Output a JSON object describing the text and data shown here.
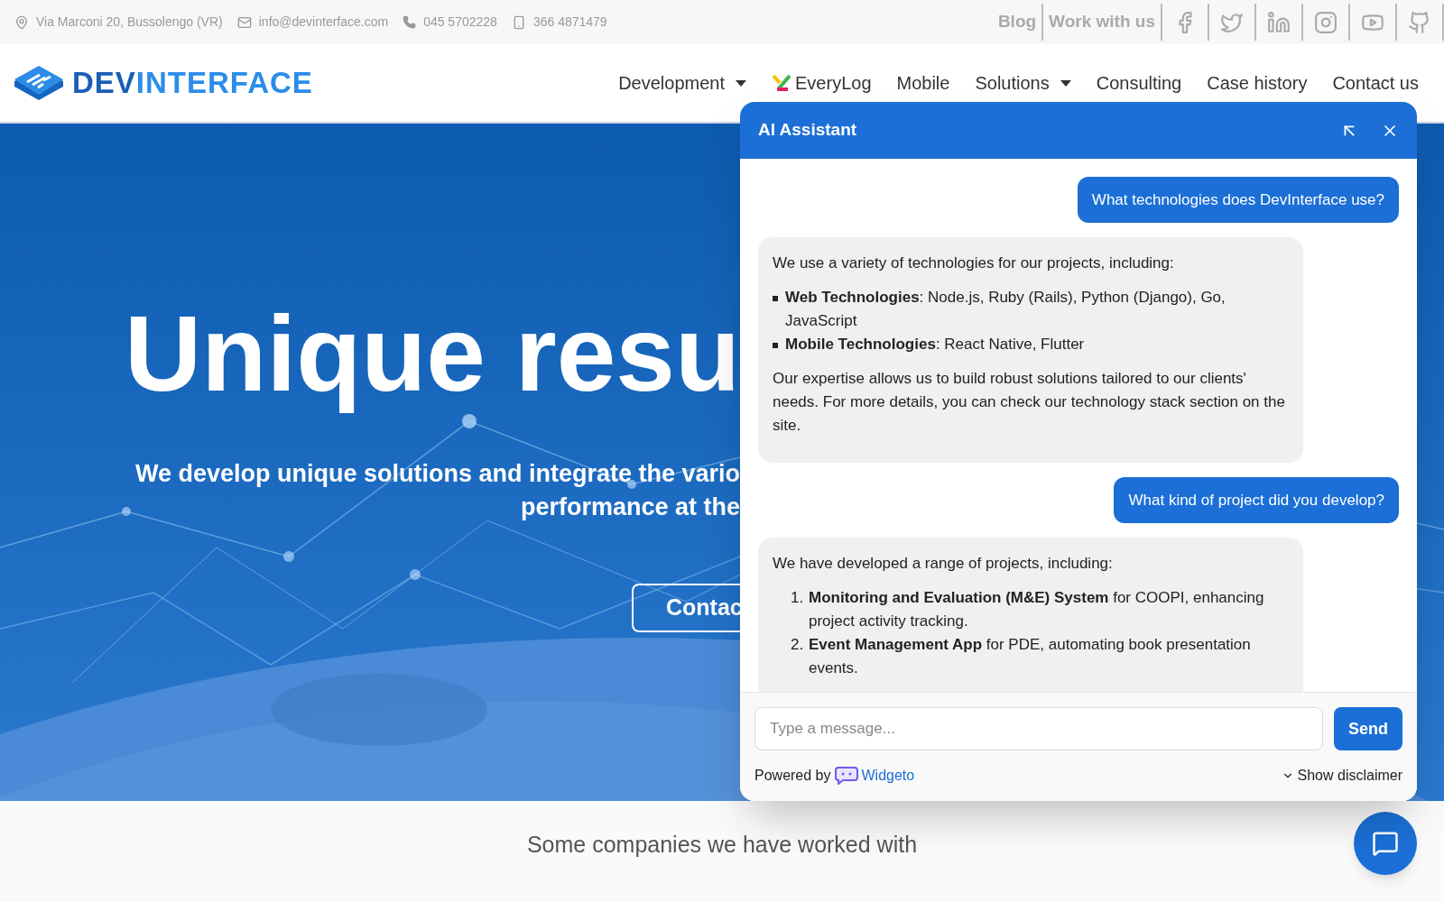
{
  "top_bar": {
    "address": "Via Marconi 20, Bussolengo (VR)",
    "email": "info@devinterface.com",
    "phone": "045 5702228",
    "mobile": "366 4871479",
    "links": [
      "Blog",
      "Work with us"
    ]
  },
  "nav": {
    "logo_first": "DEV",
    "logo_second": "INTERFACE",
    "items": [
      {
        "label": "Development",
        "kind": "dropdown"
      },
      {
        "label": "EveryLog",
        "kind": "brand"
      },
      {
        "label": "Mobile",
        "kind": "plain"
      },
      {
        "label": "Solutions",
        "kind": "dropdown"
      },
      {
        "label": "Consulting",
        "kind": "plain"
      },
      {
        "label": "Case history",
        "kind": "plain"
      },
      {
        "label": "Contact us",
        "kind": "plain"
      }
    ]
  },
  "hero": {
    "title": "Unique resu",
    "subtitle_lines": [
      "We develop unique solutions and integrate the vario",
      "performance at the"
    ],
    "button": "Contac"
  },
  "chat": {
    "title": "AI Assistant",
    "messages": [
      {
        "kind": "user",
        "text": "What technologies does DevInterface use?"
      },
      {
        "kind": "assistant",
        "blocks": [
          {
            "kind": "paragraph",
            "text": "We use a variety of technologies for our projects, including:"
          },
          {
            "kind": "bullets",
            "items": [
              "**Web Technologies**: Node.js, Ruby (Rails), Python (Django), Go, JavaScript",
              "**Mobile Technologies**: React Native, Flutter"
            ]
          },
          {
            "kind": "paragraph",
            "text": "Our expertise allows us to build robust solutions tailored to our clients' needs. For more details, you can check our technology stack section on the site."
          }
        ]
      },
      {
        "kind": "user",
        "text": "What kind of project did you develop?"
      },
      {
        "kind": "assistant",
        "blocks": [
          {
            "kind": "paragraph",
            "text": "We have developed a range of projects, including:"
          },
          {
            "kind": "numbered",
            "items": [
              {
                "number": "1.",
                "text": "**Monitoring and Evaluation (M&E) System** for COOPI, enhancing project activity tracking."
              },
              {
                "number": "2.",
                "text": "**Event Management App** for PDE, automating book presentation events."
              }
            ]
          }
        ]
      }
    ],
    "input": {
      "placeholder": "Type a message..."
    },
    "send": "Send",
    "powered_by": "Powered by",
    "brand": "Widgeto",
    "disclaimer": "Show disclaimer"
  },
  "companies": {
    "heading": "Some companies we have worked with"
  }
}
